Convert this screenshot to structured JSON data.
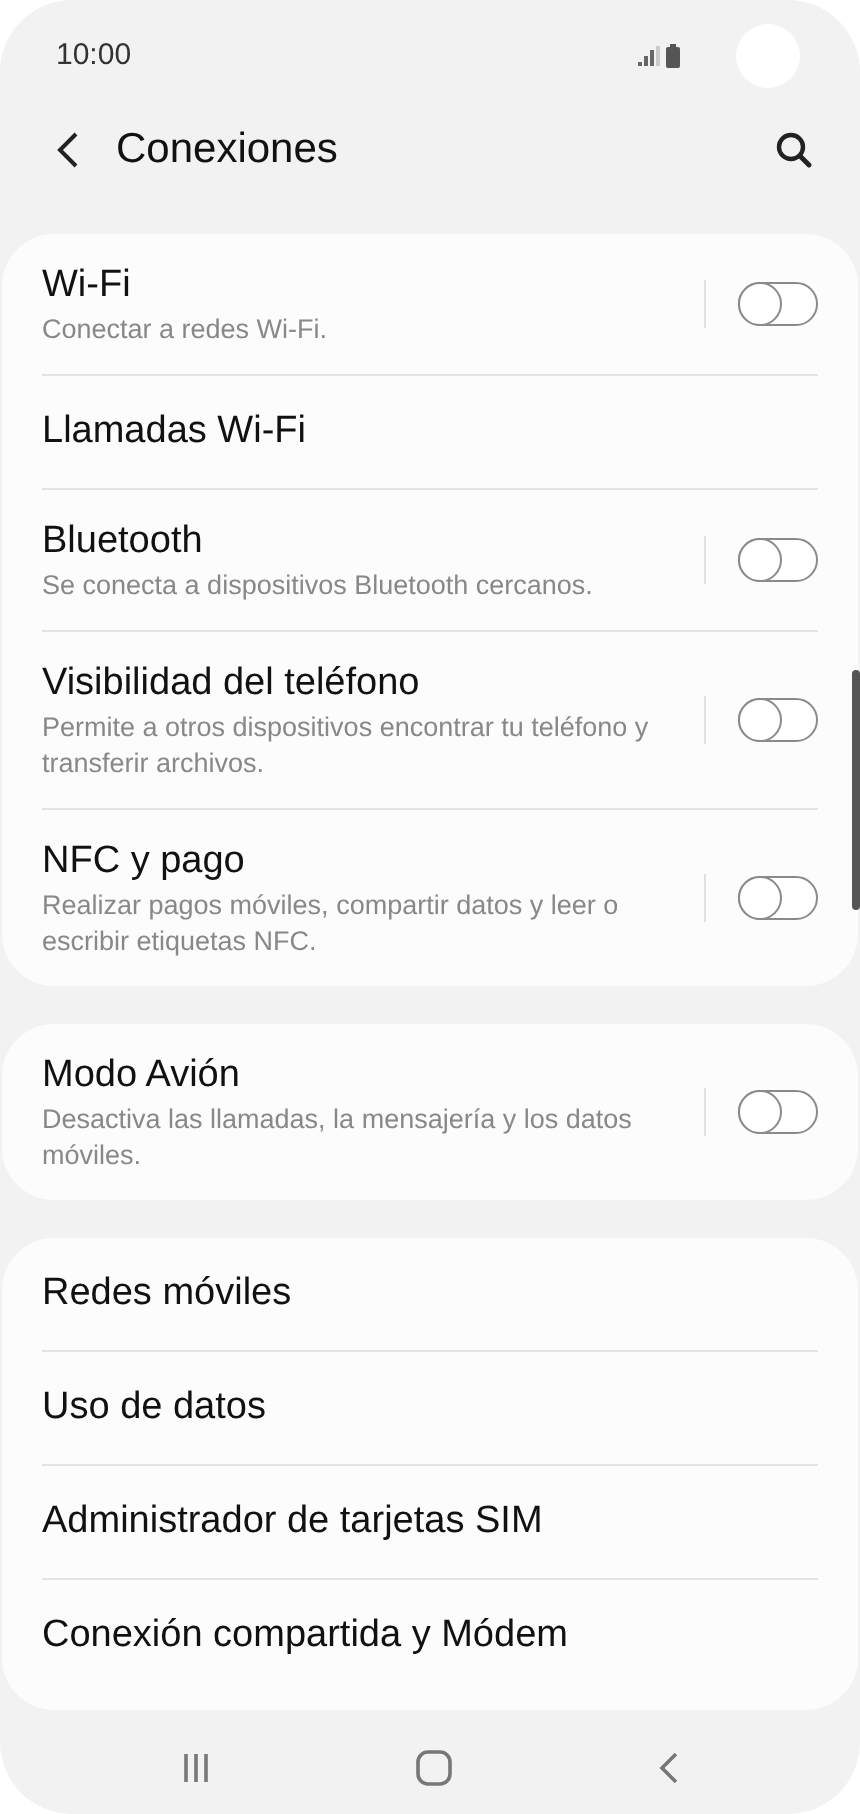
{
  "status_bar": {
    "time": "10:00"
  },
  "header": {
    "title": "Conexiones"
  },
  "groups": [
    {
      "items": [
        {
          "kind": "toggle",
          "title": "Wi-Fi",
          "subtitle": "Conectar a redes Wi-Fi.",
          "on": false
        },
        {
          "kind": "link",
          "title": "Llamadas Wi-Fi"
        },
        {
          "kind": "toggle",
          "title": "Bluetooth",
          "subtitle": "Se conecta a dispositivos Bluetooth cercanos.",
          "on": false
        },
        {
          "kind": "toggle",
          "title": "Visibilidad del teléfono",
          "subtitle": "Permite a otros dispositivos encontrar tu teléfono y transferir archivos.",
          "on": false
        },
        {
          "kind": "toggle",
          "title": "NFC y pago",
          "subtitle": "Realizar pagos móviles, compartir datos y leer o escribir etiquetas NFC.",
          "on": false
        }
      ]
    },
    {
      "items": [
        {
          "kind": "toggle",
          "title": "Modo Avión",
          "subtitle": "Desactiva las llamadas, la mensajería y los datos móviles.",
          "on": false
        }
      ]
    },
    {
      "items": [
        {
          "kind": "link",
          "title": "Redes móviles"
        },
        {
          "kind": "link",
          "title": "Uso de datos"
        },
        {
          "kind": "link",
          "title": "Administrador de tarjetas SIM"
        },
        {
          "kind": "link",
          "title": "Conexión compartida y Módem"
        }
      ]
    }
  ]
}
